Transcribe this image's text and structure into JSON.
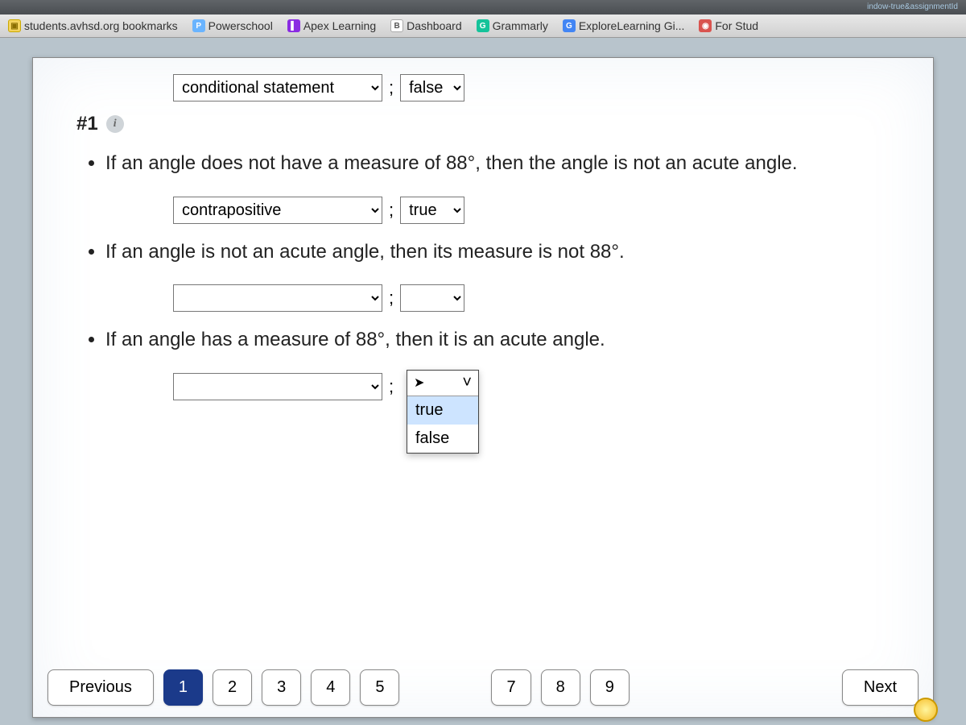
{
  "chrome": {
    "url_fragment": "indow-true&assignmentId"
  },
  "bookmarks": [
    {
      "label": "students.avhsd.org bookmarks",
      "icon": "folder"
    },
    {
      "label": "Powerschool",
      "icon": "blue"
    },
    {
      "label": "Apex Learning",
      "icon": "apex"
    },
    {
      "label": "Dashboard",
      "icon": "dash"
    },
    {
      "label": "Grammarly",
      "icon": "gram"
    },
    {
      "label": "ExploreLearning Gi...",
      "icon": "g"
    },
    {
      "label": "For Stud",
      "icon": "red"
    }
  ],
  "question": {
    "number": "#1",
    "row1": {
      "type_value": "conditional statement",
      "truth_value": "false"
    },
    "stmt1": "If an angle does not have a measure of 88°, then the angle is not an acute angle.",
    "row2": {
      "type_value": "contrapositive",
      "truth_value": "true"
    },
    "stmt2": "If an angle is not an acute angle, then its measure is not 88°.",
    "row3": {
      "type_value": "",
      "truth_value": ""
    },
    "stmt3": "If an angle has a measure of 88°, then it is an acute angle.",
    "row4": {
      "type_value": "",
      "truth_value": ""
    },
    "dropdown_open": {
      "options": [
        "true",
        "false"
      ]
    },
    "semicolon": ";"
  },
  "nav": {
    "prev": "Previous",
    "next": "Next",
    "pages": [
      "1",
      "2",
      "3",
      "4",
      "5",
      "7",
      "8",
      "9"
    ],
    "active": "1"
  }
}
